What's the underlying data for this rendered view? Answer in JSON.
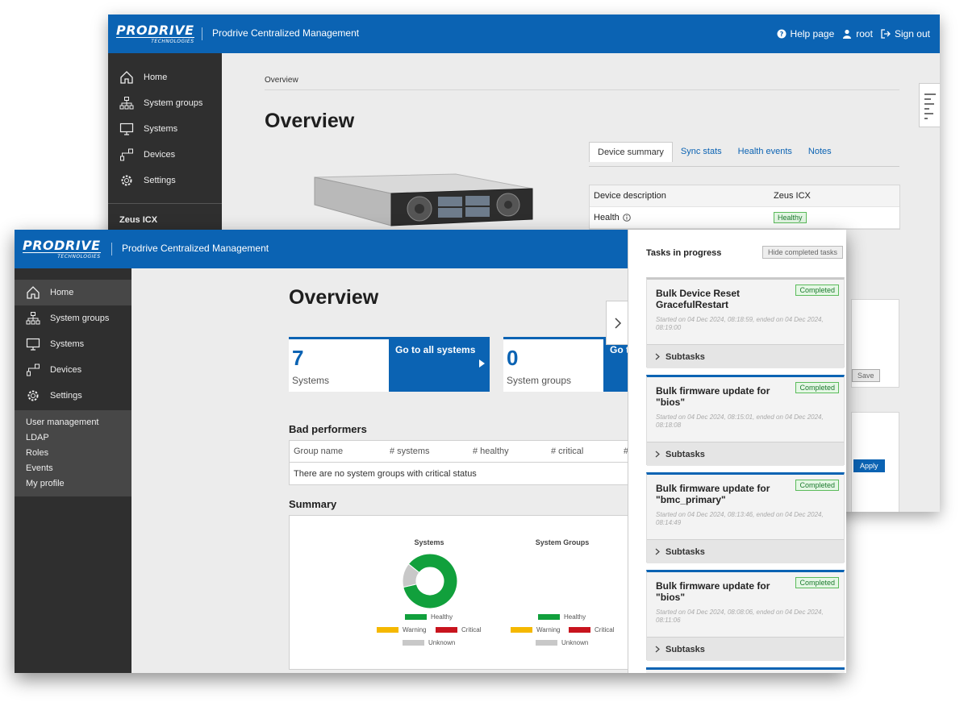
{
  "brand": {
    "logo_main": "PRODRIVE",
    "logo_sub": "TECHNOLOGIES",
    "app_title": "Prodrive Centralized Management"
  },
  "header": {
    "help": "Help page",
    "user": "root",
    "signout": "Sign out"
  },
  "nav": [
    "Home",
    "System groups",
    "Systems",
    "Devices",
    "Settings"
  ],
  "back": {
    "section_label": "Zeus ICX",
    "breadcrumb": "Overview",
    "title": "Overview",
    "tabs": [
      "Device summary",
      "Sync stats",
      "Health events",
      "Notes"
    ],
    "rows": [
      {
        "k": "Device description",
        "v": "Zeus ICX"
      },
      {
        "k": "Health",
        "v": "Healthy"
      }
    ],
    "save": "Save",
    "apply": "Apply"
  },
  "front": {
    "submenu": [
      "User management",
      "LDAP",
      "Roles",
      "Events",
      "My profile"
    ],
    "title": "Overview",
    "stats": [
      {
        "num": "7",
        "label": "Systems",
        "go": "Go to all systems"
      },
      {
        "num": "0",
        "label": "System groups",
        "go": "Go to all groups"
      }
    ],
    "bad_performers": {
      "title": "Bad performers",
      "columns": [
        "Group name",
        "# systems",
        "# healthy",
        "# critical",
        "#"
      ],
      "empty": "There are no system groups with critical status"
    },
    "summary": {
      "title": "Summary",
      "charts": [
        "Systems",
        "System Groups"
      ],
      "legend": [
        "Healthy",
        "Warning",
        "Critical",
        "Unknown"
      ]
    }
  },
  "colors": {
    "healthy": "#11a03c",
    "warning": "#f5b800",
    "critical": "#c8141e",
    "unknown": "#c8c8c8",
    "brand": "#0b63b3"
  },
  "chart_data": [
    {
      "type": "pie",
      "title": "Systems",
      "categories": [
        "Healthy",
        "Warning",
        "Critical",
        "Unknown"
      ],
      "values": [
        6,
        0,
        0,
        1
      ]
    },
    {
      "type": "pie",
      "title": "System Groups",
      "categories": [
        "Healthy",
        "Warning",
        "Critical",
        "Unknown"
      ],
      "values": []
    }
  ],
  "tasks": {
    "title": "Tasks in progress",
    "hide_btn": "Hide completed tasks",
    "subtasks_label": "Subtasks",
    "items": [
      {
        "name": "Bulk Device Reset GracefulRestart",
        "status": "Completed",
        "time": "Started on 04 Dec 2024, 08:18:59, ended on 04 Dec 2024, 08:19:00"
      },
      {
        "name": "Bulk firmware update for \"bios\"",
        "status": "Completed",
        "time": "Started on 04 Dec 2024, 08:15:01, ended on 04 Dec 2024, 08:18:08"
      },
      {
        "name": "Bulk firmware update for \"bmc_primary\"",
        "status": "Completed",
        "time": "Started on 04 Dec 2024, 08:13:46, ended on 04 Dec 2024, 08:14:49"
      },
      {
        "name": "Bulk firmware update for \"bios\"",
        "status": "Completed",
        "time": "Started on 04 Dec 2024, 08:08:06, ended on 04 Dec 2024, 08:11:06"
      }
    ]
  }
}
